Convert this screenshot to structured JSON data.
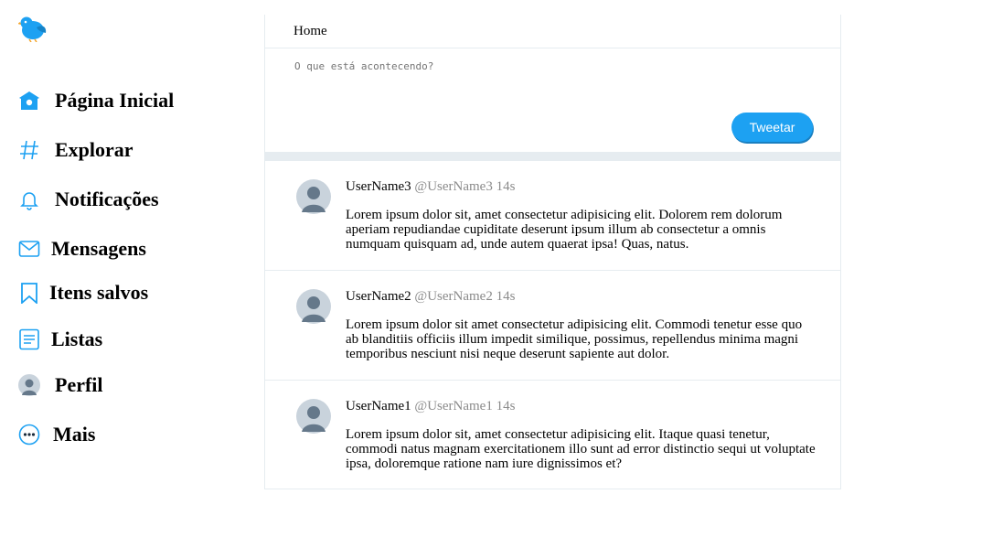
{
  "colors": {
    "accent": "#1da1f2",
    "border": "#e6ecf0",
    "avatar_bg": "#c9d3dc",
    "avatar_fg": "#65788a"
  },
  "sidebar": {
    "logo_icon": "bird-icon",
    "items": [
      {
        "label": "Página Inicial",
        "icon": "home-icon"
      },
      {
        "label": "Explorar",
        "icon": "hashtag-icon"
      },
      {
        "label": "Notificações",
        "icon": "bell-icon"
      },
      {
        "label": "Mensagens",
        "icon": "envelope-icon"
      },
      {
        "label": "Itens salvos",
        "icon": "bookmark-icon"
      },
      {
        "label": "Listas",
        "icon": "list-icon"
      },
      {
        "label": "Perfil",
        "icon": "avatar-icon"
      },
      {
        "label": "Mais",
        "icon": "more-icon"
      }
    ]
  },
  "header": {
    "title": "Home"
  },
  "compose": {
    "placeholder": "O que está acontecendo?",
    "button_label": "Tweetar"
  },
  "posts": [
    {
      "username": "UserName3",
      "handle": "@UserName3",
      "time": "14s",
      "text": "Lorem ipsum dolor sit, amet consectetur adipisicing elit. Dolorem rem dolorum aperiam repudiandae cupiditate deserunt ipsum illum ab consectetur a omnis numquam quisquam ad, unde autem quaerat ipsa! Quas, natus."
    },
    {
      "username": "UserName2",
      "handle": "@UserName2",
      "time": "14s",
      "text": "Lorem ipsum dolor sit amet consectetur adipisicing elit. Commodi tenetur esse quo ab blanditiis officiis illum impedit similique, possimus, repellendus minima magni temporibus nesciunt nisi neque deserunt sapiente aut dolor."
    },
    {
      "username": "UserName1",
      "handle": "@UserName1",
      "time": "14s",
      "text": "Lorem ipsum dolor sit, amet consectetur adipisicing elit. Itaque quasi tenetur, commodi natus magnam exercitationem illo sunt ad error distinctio sequi ut voluptate ipsa, doloremque ratione nam iure dignissimos et?"
    }
  ]
}
